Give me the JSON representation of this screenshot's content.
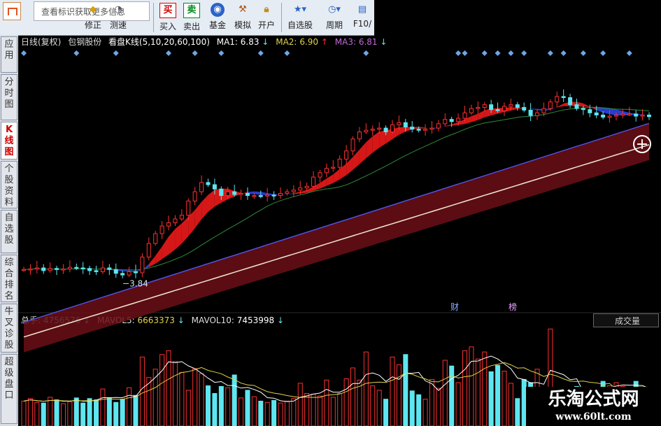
{
  "toolbar": {
    "search_placeholder": "查看标识获取更多信息",
    "buttons": [
      {
        "icon": "modify-icon",
        "label": "修正"
      },
      {
        "icon": "speed-icon",
        "label": "测速"
      },
      {
        "icon": "buy-icon",
        "glyph": "买",
        "label": "买入",
        "color": "#d00000"
      },
      {
        "icon": "sell-icon",
        "glyph": "卖",
        "label": "卖出",
        "color": "#00891a"
      },
      {
        "icon": "fund-icon",
        "label": "基金"
      },
      {
        "icon": "hammer-icon",
        "label": "模拟"
      },
      {
        "icon": "lock-icon",
        "label": "开户"
      },
      {
        "icon": "watchlist-icon",
        "label": "自选股"
      },
      {
        "icon": "clock-icon",
        "label": "周期"
      },
      {
        "icon": "f10-icon",
        "label": "F10/"
      }
    ]
  },
  "left_tabs": [
    {
      "label": "应用",
      "active": false
    },
    {
      "label": "分时图",
      "active": false
    },
    {
      "label": "K线图",
      "active": true
    },
    {
      "label": "个股资料",
      "active": false
    },
    {
      "label": "自选股",
      "active": false
    },
    {
      "label": "综合排名",
      "active": false
    },
    {
      "label": "牛叉诊股",
      "active": false
    },
    {
      "label": "超级盘口",
      "active": false
    }
  ],
  "kline_header": {
    "period": "日线(复权)",
    "stock": "包钢股份",
    "indicator": "看盘K线(5,10,20,60,100)",
    "ma1_label": "MA1:",
    "ma1_value": "6.83",
    "ma1_arrow": "↓",
    "ma2_label": "MA2:",
    "ma2_value": "6.90",
    "ma2_arrow": "↑",
    "ma3_label": "MA3:",
    "ma3_value": "6.81",
    "ma3_arrow": "↓"
  },
  "volume_header": {
    "total_label": "总手:",
    "total_value": "4756576",
    "total_arrow": "↓",
    "mavol5_label": "MAVOL5:",
    "mavol5_value": "6663373",
    "mavol5_arrow": "↓",
    "mavol10_label": "MAVOL10:",
    "mavol10_value": "7453998",
    "mavol10_arrow": "↓",
    "dropdown_selected": "成交量"
  },
  "chart_labels": {
    "low_price": "3.84",
    "badge_cai": "财",
    "badge_bang": "榜"
  },
  "colors": {
    "up": "#ff3030",
    "down": "#5ee6f0",
    "ma1": "#ffffff",
    "ma2": "#e0d24a",
    "ma3": "#c06bd8",
    "ma60": "#5050e0",
    "ma100": "#ffffff",
    "band": "#6b0f16"
  },
  "watermark": {
    "title": "乐淘公式网",
    "url": "www.60lt.com"
  },
  "chart_data": {
    "type": "candlestick",
    "title": "",
    "price_ylim": [
      3.6,
      7.2
    ],
    "volume_ylim": [
      0,
      16000000
    ],
    "low_annotation": 3.84,
    "close": [
      4.02,
      4.03,
      4.05,
      4.0,
      4.04,
      4.02,
      4.03,
      4.06,
      4.05,
      4.04,
      4.0,
      3.98,
      4.05,
      4.02,
      3.95,
      3.92,
      3.98,
      3.96,
      4.25,
      4.5,
      4.68,
      4.82,
      4.88,
      4.95,
      5.02,
      5.28,
      5.45,
      5.62,
      5.58,
      5.5,
      5.38,
      5.45,
      5.4,
      5.42,
      5.38,
      5.38,
      5.37,
      5.39,
      5.38,
      5.42,
      5.45,
      5.48,
      5.52,
      5.55,
      5.72,
      5.8,
      5.88,
      5.9,
      6.05,
      6.2,
      6.42,
      6.55,
      6.58,
      6.6,
      6.62,
      6.55,
      6.68,
      6.72,
      6.64,
      6.6,
      6.58,
      6.6,
      6.62,
      6.7,
      6.78,
      6.74,
      6.8,
      6.9,
      6.98,
      7.0,
      7.05,
      6.96,
      6.94,
      7.02,
      7.05,
      7.0,
      6.95,
      6.85,
      6.9,
      6.98,
      7.1,
      7.2,
      7.18,
      7.05,
      6.98,
      6.96,
      6.9,
      6.86,
      6.82,
      6.84,
      6.86,
      6.88,
      6.88,
      6.84,
      6.86,
      6.83
    ],
    "volume": [
      3900000,
      4300000,
      3700000,
      3600000,
      4500000,
      4100000,
      3500000,
      3800000,
      4400000,
      3600000,
      4300000,
      4100000,
      5800000,
      4400000,
      3700000,
      4200000,
      6000000,
      4800000,
      10800000,
      7600000,
      8900000,
      11200000,
      11800000,
      10100000,
      8400000,
      5600000,
      9000000,
      8200000,
      6300000,
      5100000,
      6200000,
      6000000,
      8000000,
      4400000,
      5600000,
      4600000,
      3900000,
      3700000,
      4000000,
      3600000,
      3900000,
      4300000,
      6700000,
      5100000,
      5000000,
      4700000,
      7200000,
      4500000,
      5100000,
      7400000,
      9100000,
      7200000,
      11600000,
      6300000,
      5600000,
      4200000,
      10800000,
      9600000,
      11200000,
      5500000,
      4900000,
      4200000,
      7300000,
      5900000,
      10300000,
      9400000,
      6800000,
      11800000,
      12400000,
      10500000,
      11600000,
      8500000,
      9500000,
      8600000,
      6700000,
      4300000,
      7300000,
      6800000,
      8900000,
      5400000,
      15200000,
      5600000,
      5100000,
      4900000,
      6200000,
      5000000,
      5400000,
      5800000,
      7000000,
      6300000,
      6800000,
      6200000,
      5700000,
      7000000,
      5900000,
      4756576
    ]
  }
}
